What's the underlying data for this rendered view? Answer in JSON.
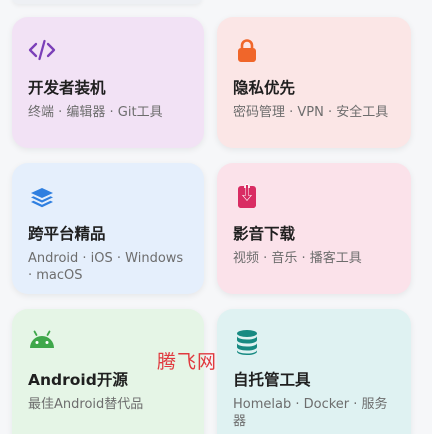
{
  "cards": [
    {
      "title": "开发者装机",
      "description": "终端 · 编辑器 · Git工具",
      "icon": "code-icon",
      "icon_color": "#7b3fb8"
    },
    {
      "title": "隐私优先",
      "description": "密码管理 · VPN · 安全工具",
      "icon": "lock-icon",
      "icon_color": "#f0662a"
    },
    {
      "title": "跨平台精品",
      "description": "Android · iOS · Windows · macOS",
      "icon": "layers-icon",
      "icon_color": "#2f7fe0"
    },
    {
      "title": "影音下载",
      "description": "视频 · 音乐 · 播客工具",
      "icon": "download-icon",
      "icon_color": "#d92c63"
    },
    {
      "title": "Android开源",
      "description": "最佳Android替代品",
      "icon": "android-icon",
      "icon_color": "#3ea74a"
    },
    {
      "title": "自托管工具",
      "description": "Homelab · Docker · 服务器",
      "icon": "database-icon",
      "icon_color": "#178a82"
    }
  ],
  "watermark": "腾飞网"
}
